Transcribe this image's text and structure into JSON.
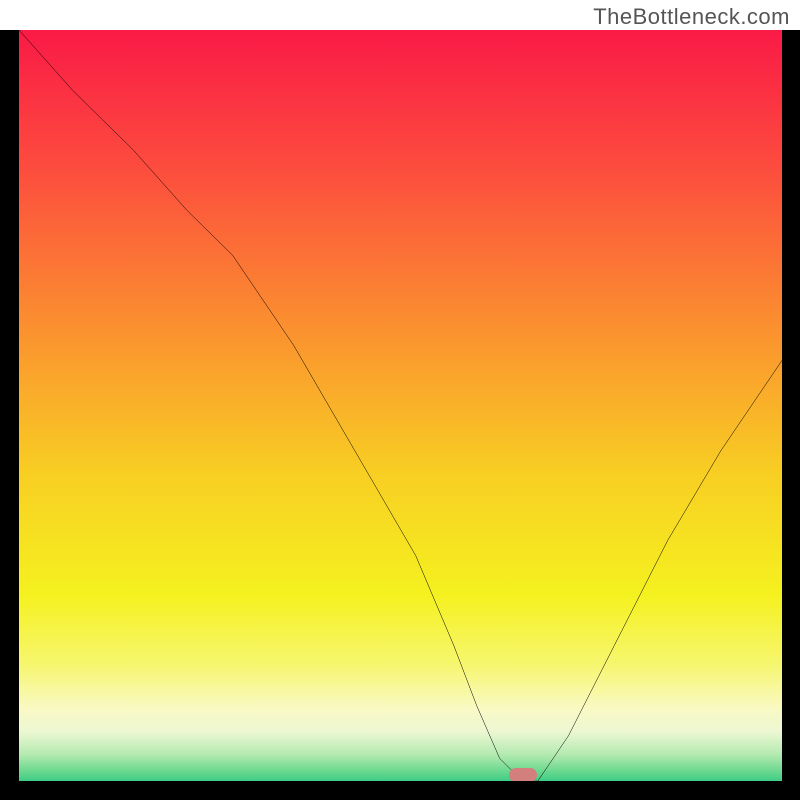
{
  "watermark": "TheBottleneck.com",
  "chart_data": {
    "type": "line",
    "title": "",
    "xlabel": "",
    "ylabel": "",
    "x_range": [
      0,
      100
    ],
    "y_range": [
      0,
      100
    ],
    "series": [
      {
        "name": "curve",
        "x": [
          0,
          7,
          15,
          22,
          28,
          36,
          44,
          52,
          57,
          60,
          63,
          66,
          68,
          72,
          78,
          85,
          92,
          100
        ],
        "y": [
          100,
          92,
          84,
          76,
          70,
          58,
          44,
          30,
          18,
          10,
          3,
          0,
          0,
          6,
          18,
          32,
          44,
          56
        ]
      }
    ],
    "marker": {
      "x": 66,
      "y": 0.8
    },
    "background_gradient": {
      "stops": [
        {
          "offset": 0,
          "color": "#fa1a46"
        },
        {
          "offset": 18,
          "color": "#fc4c3e"
        },
        {
          "offset": 38,
          "color": "#fb8d30"
        },
        {
          "offset": 58,
          "color": "#f8ce23"
        },
        {
          "offset": 74,
          "color": "#f5f11f"
        },
        {
          "offset": 83,
          "color": "#f6f66d"
        },
        {
          "offset": 89,
          "color": "#f9f9c5"
        },
        {
          "offset": 92,
          "color": "#ecf7d2"
        },
        {
          "offset": 95,
          "color": "#b3eab0"
        },
        {
          "offset": 97,
          "color": "#6fd990"
        },
        {
          "offset": 99,
          "color": "#2bc881"
        },
        {
          "offset": 100,
          "color": "#0ec17b"
        }
      ]
    }
  }
}
